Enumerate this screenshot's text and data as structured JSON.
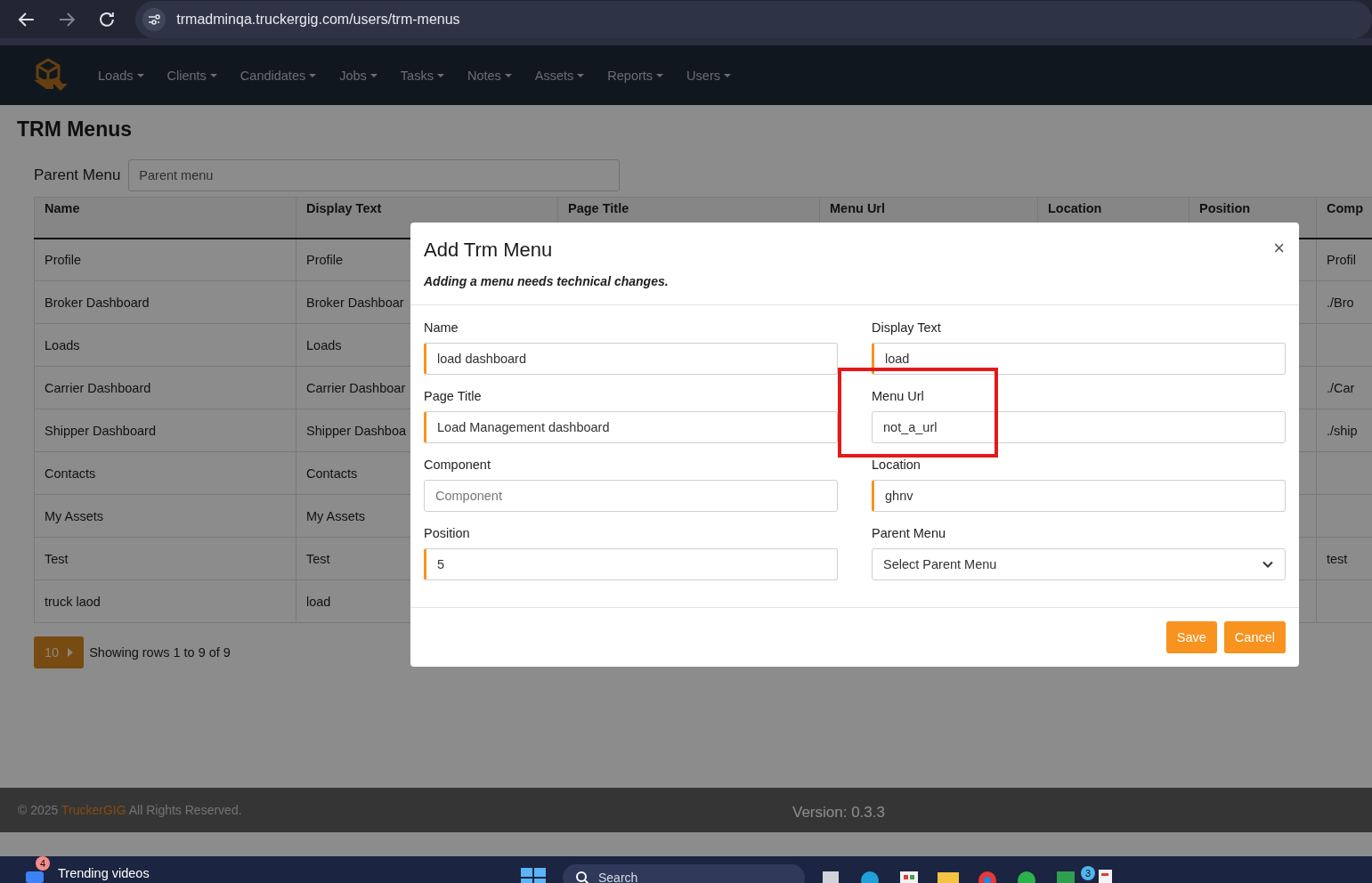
{
  "browser": {
    "url": "trmadminqa.truckergig.com/users/trm-menus"
  },
  "navbar": {
    "items": [
      {
        "label": "Loads"
      },
      {
        "label": "Clients"
      },
      {
        "label": "Candidates"
      },
      {
        "label": "Jobs"
      },
      {
        "label": "Tasks"
      },
      {
        "label": "Notes"
      },
      {
        "label": "Assets"
      },
      {
        "label": "Reports"
      },
      {
        "label": "Users"
      }
    ]
  },
  "page": {
    "title": "TRM Menus",
    "filter": {
      "label": "Parent Menu",
      "placeholder": "Parent menu"
    },
    "table": {
      "columns": [
        "Name",
        "Display Text",
        "Page Title",
        "Menu Url",
        "Location",
        "Position",
        "Comp"
      ],
      "rows": [
        {
          "name": "Profile",
          "display_text": "Profile",
          "column_7": "Profil"
        },
        {
          "name": "Broker Dashboard",
          "display_text": "Broker Dashboar",
          "column_7": "./Bro"
        },
        {
          "name": "Loads",
          "display_text": "Loads"
        },
        {
          "name": "Carrier Dashboard",
          "display_text": "Carrier Dashboar",
          "column_7": "./Car"
        },
        {
          "name": "Shipper Dashboard",
          "display_text": "Shipper Dashboa",
          "column_7": "./ship"
        },
        {
          "name": "Contacts",
          "display_text": "Contacts"
        },
        {
          "name": "My Assets",
          "display_text": "My Assets"
        },
        {
          "name": "Test",
          "display_text": "Test",
          "column_7": "test"
        },
        {
          "name": "truck laod",
          "display_text": "load"
        }
      ]
    },
    "pagination": {
      "page_size": "10",
      "summary": "Showing rows 1 to 9 of 9"
    }
  },
  "modal": {
    "title": "Add Trm Menu",
    "close": "×",
    "note": "Adding a menu needs technical changes.",
    "fields": [
      {
        "kind": "text",
        "label": "Name",
        "value": "load dashboard",
        "accent": true
      },
      {
        "kind": "text",
        "label": "Display Text",
        "value": "load",
        "accent": true
      },
      {
        "kind": "text",
        "label": "Page Title",
        "value": "Load Management dashboard",
        "accent": true
      },
      {
        "kind": "text",
        "label": "Menu Url",
        "value": "not_a_url",
        "accent": false,
        "annotated": true
      },
      {
        "kind": "text",
        "label": "Component",
        "placeholder": "Component",
        "accent": false
      },
      {
        "kind": "text",
        "label": "Location",
        "value": "ghnv",
        "accent": true
      },
      {
        "kind": "text",
        "label": "Position",
        "value": "5",
        "accent": true
      },
      {
        "kind": "select",
        "label": "Parent Menu",
        "value": "Select Parent Menu",
        "accent": false
      }
    ],
    "buttons": [
      "Save",
      "Cancel"
    ]
  },
  "footer": {
    "copyright": "© 2025",
    "brand": "TruckerGIG",
    "rights": "All Rights Reserved.",
    "version": "Version: 0.3.3"
  },
  "taskbar": {
    "widget": {
      "badge": "4",
      "label": "Trending videos"
    },
    "search": {
      "placeholder": "Search"
    },
    "chat_badge": "3"
  }
}
